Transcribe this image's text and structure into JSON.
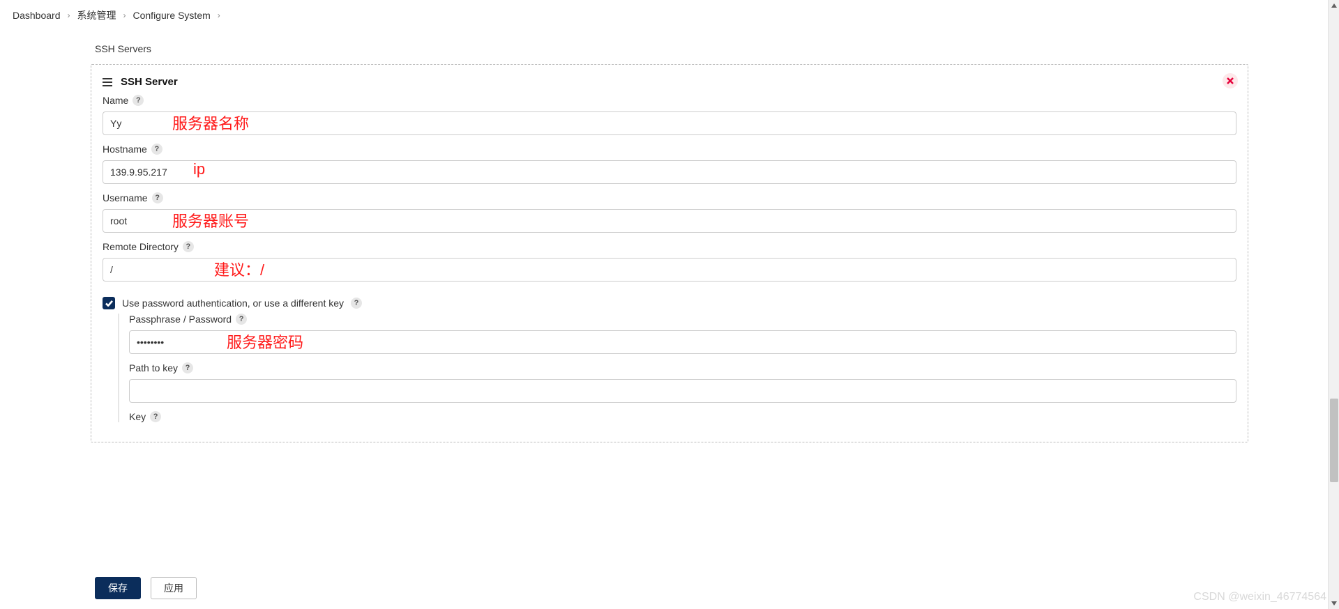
{
  "breadcrumb": {
    "items": [
      "Dashboard",
      "系统管理",
      "Configure System"
    ]
  },
  "section_title": "SSH Servers",
  "panel": {
    "title": "SSH Server",
    "fields": {
      "name": {
        "label": "Name",
        "value": "Yy"
      },
      "hostname": {
        "label": "Hostname",
        "value": "139.9.95.217"
      },
      "username": {
        "label": "Username",
        "value": "root"
      },
      "remote_dir": {
        "label": "Remote Directory",
        "value": "/"
      },
      "use_password": {
        "label": "Use password authentication, or use a different key",
        "checked": true
      },
      "passphrase": {
        "label": "Passphrase / Password",
        "value": "••••••••"
      },
      "path_to_key": {
        "label": "Path to key",
        "value": ""
      },
      "key": {
        "label": "Key"
      }
    }
  },
  "annotations": {
    "name": "服务器名称",
    "hostname": "ip",
    "username": "服务器账号",
    "remote_dir": "建议：/",
    "passphrase": "服务器密码"
  },
  "footer": {
    "save": "保存",
    "apply": "应用"
  },
  "watermark": "CSDN @weixin_46774564",
  "help_glyph": "?"
}
